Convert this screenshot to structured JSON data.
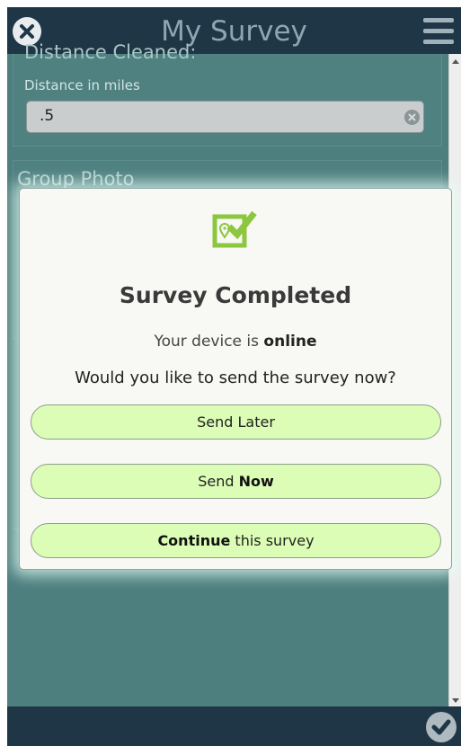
{
  "header": {
    "title": "My Survey",
    "close_icon": "close-circle-icon",
    "menu_icon": "hamburger-menu-icon"
  },
  "question": {
    "label": "Distance Cleaned:",
    "hint": "Distance in miles",
    "value": ".5"
  },
  "group_photo": {
    "label": "Group Photo"
  },
  "dialog": {
    "icon": "survey-check-icon",
    "title": "Survey Completed",
    "status_prefix": "Your device is",
    "status_value": "online",
    "prompt": "Would you like to send the survey now?",
    "send_later_label": "Send Later",
    "send_now_prefix": "Send",
    "send_now_bold": "Now",
    "continue_bold": "Continue",
    "continue_suffix": "this survey"
  },
  "footer": {
    "submit_icon": "checkmark-circle-icon"
  },
  "colors": {
    "header_bg": "#1f3646",
    "page_bg": "#4d7f7f",
    "button_bg": "#dcfdb5",
    "icon_green": "#8dc63f"
  }
}
